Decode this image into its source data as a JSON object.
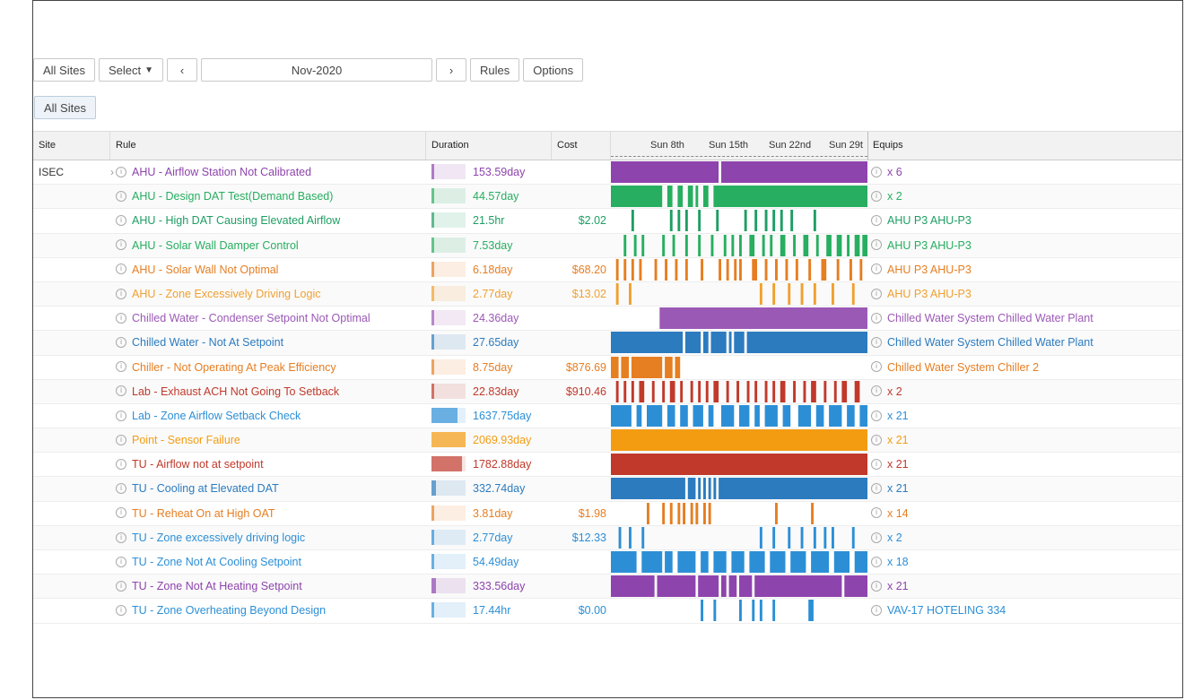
{
  "toolbar": {
    "all_sites": "All Sites",
    "select": "Select",
    "select_caret": "▼",
    "prev": "‹",
    "month": "Nov-2020",
    "next": "›",
    "rules": "Rules",
    "options": "Options"
  },
  "filter_tag": "All Sites",
  "columns": {
    "site": "Site",
    "rule": "Rule",
    "duration": "Duration",
    "cost": "Cost",
    "equips": "Equips"
  },
  "timeline_ticks": [
    "Sun 8th",
    "Sun 15th",
    "Sun 22nd",
    "Sun 29t"
  ],
  "rows": [
    {
      "site": "ISEC",
      "rule": "AHU - Airflow Station Not Calibrated",
      "color": "#8e44ad",
      "duration": "153.59day",
      "duration_fraction": 0.07,
      "cost": "",
      "equips": "x 6",
      "timeline": [
        [
          0,
          0.42
        ],
        [
          0.43,
          1
        ]
      ]
    },
    {
      "site": "",
      "rule": "AHU - Design DAT Test(Demand Based)",
      "color": "#27ae60",
      "duration": "44.57day",
      "duration_fraction": 0.02,
      "cost": "",
      "equips": "x 2",
      "timeline": [
        [
          0,
          0.2
        ],
        [
          0.22,
          0.24
        ],
        [
          0.26,
          0.28
        ],
        [
          0.3,
          0.32
        ],
        [
          0.33,
          0.34
        ],
        [
          0.36,
          0.38
        ],
        [
          0.4,
          1
        ]
      ]
    },
    {
      "site": "",
      "rule": "AHU - High DAT Causing Elevated Airflow",
      "color": "#1e9e64",
      "duration": "21.5hr",
      "duration_fraction": 0.01,
      "cost": "$2.02",
      "equips": "AHU P3 AHU-P3",
      "timeline": [
        [
          0.08,
          0.09
        ],
        [
          0.23,
          0.24
        ],
        [
          0.26,
          0.27
        ],
        [
          0.29,
          0.3
        ],
        [
          0.34,
          0.35
        ],
        [
          0.41,
          0.42
        ],
        [
          0.52,
          0.53
        ],
        [
          0.56,
          0.57
        ],
        [
          0.6,
          0.61
        ],
        [
          0.63,
          0.64
        ],
        [
          0.66,
          0.67
        ],
        [
          0.7,
          0.71
        ],
        [
          0.79,
          0.8
        ]
      ]
    },
    {
      "site": "",
      "rule": "AHU - Solar Wall Damper Control",
      "color": "#27ae60",
      "duration": "7.53day",
      "duration_fraction": 0.01,
      "cost": "",
      "equips": "AHU P3 AHU-P3",
      "timeline": [
        [
          0.05,
          0.06
        ],
        [
          0.09,
          0.1
        ],
        [
          0.12,
          0.13
        ],
        [
          0.2,
          0.21
        ],
        [
          0.24,
          0.25
        ],
        [
          0.29,
          0.3
        ],
        [
          0.34,
          0.35
        ],
        [
          0.39,
          0.4
        ],
        [
          0.44,
          0.45
        ],
        [
          0.47,
          0.48
        ],
        [
          0.5,
          0.51
        ],
        [
          0.54,
          0.56
        ],
        [
          0.59,
          0.6
        ],
        [
          0.62,
          0.63
        ],
        [
          0.66,
          0.68
        ],
        [
          0.71,
          0.72
        ],
        [
          0.75,
          0.77
        ],
        [
          0.8,
          0.81
        ],
        [
          0.84,
          0.86
        ],
        [
          0.88,
          0.9
        ],
        [
          0.92,
          0.93
        ],
        [
          0.95,
          0.97
        ],
        [
          0.98,
          1
        ]
      ]
    },
    {
      "site": "",
      "rule": "AHU - Solar Wall Not Optimal",
      "color": "#e67e22",
      "duration": "6.18day",
      "duration_fraction": 0.01,
      "cost": "$68.20",
      "equips": "AHU P3 AHU-P3",
      "timeline": [
        [
          0.02,
          0.03
        ],
        [
          0.05,
          0.06
        ],
        [
          0.08,
          0.09
        ],
        [
          0.11,
          0.12
        ],
        [
          0.17,
          0.18
        ],
        [
          0.21,
          0.22
        ],
        [
          0.25,
          0.26
        ],
        [
          0.29,
          0.3
        ],
        [
          0.35,
          0.36
        ],
        [
          0.42,
          0.43
        ],
        [
          0.45,
          0.46
        ],
        [
          0.48,
          0.49
        ],
        [
          0.5,
          0.51
        ],
        [
          0.55,
          0.57
        ],
        [
          0.6,
          0.61
        ],
        [
          0.64,
          0.65
        ],
        [
          0.68,
          0.69
        ],
        [
          0.72,
          0.73
        ],
        [
          0.77,
          0.78
        ],
        [
          0.82,
          0.84
        ],
        [
          0.88,
          0.89
        ],
        [
          0.93,
          0.94
        ],
        [
          0.97,
          0.98
        ]
      ]
    },
    {
      "site": "",
      "rule": "AHU - Zone Excessively Driving Logic",
      "color": "#f0a030",
      "duration": "2.77day",
      "duration_fraction": 0.01,
      "cost": "$13.02",
      "equips": "AHU P3 AHU-P3",
      "timeline": [
        [
          0.02,
          0.03
        ],
        [
          0.07,
          0.08
        ],
        [
          0.58,
          0.59
        ],
        [
          0.63,
          0.64
        ],
        [
          0.69,
          0.7
        ],
        [
          0.74,
          0.75
        ],
        [
          0.79,
          0.8
        ],
        [
          0.86,
          0.87
        ],
        [
          0.94,
          0.95
        ]
      ]
    },
    {
      "site": "",
      "rule": "Chilled Water - Condenser Setpoint Not Optimal",
      "color": "#9b59b6",
      "duration": "24.36day",
      "duration_fraction": 0.01,
      "cost": "",
      "equips": "Chilled Water System Chilled Water Plant",
      "timeline": [
        [
          0.19,
          1
        ]
      ]
    },
    {
      "site": "",
      "rule": "Chilled Water - Not At Setpoint",
      "color": "#2c7bbf",
      "duration": "27.65day",
      "duration_fraction": 0.01,
      "cost": "",
      "equips": "Chilled Water System Chilled Water Plant",
      "timeline": [
        [
          0,
          0.28
        ],
        [
          0.29,
          0.35
        ],
        [
          0.36,
          0.38
        ],
        [
          0.39,
          0.45
        ],
        [
          0.46,
          0.47
        ],
        [
          0.48,
          0.52
        ],
        [
          0.53,
          1
        ]
      ]
    },
    {
      "site": "",
      "rule": "Chiller - Not Operating At Peak Efficiency",
      "color": "#e67e22",
      "duration": "8.75day",
      "duration_fraction": 0.01,
      "cost": "$876.69",
      "equips": "Chilled Water System Chiller 2",
      "timeline": [
        [
          0,
          0.03
        ],
        [
          0.04,
          0.07
        ],
        [
          0.08,
          0.2
        ],
        [
          0.21,
          0.24
        ],
        [
          0.25,
          0.27
        ]
      ]
    },
    {
      "site": "",
      "rule": "Lab - Exhaust ACH Not Going To Setback",
      "color": "#c0392b",
      "duration": "22.83day",
      "duration_fraction": 0.01,
      "cost": "$910.46",
      "equips": "x 2",
      "timeline": [
        [
          0.02,
          0.03
        ],
        [
          0.05,
          0.06
        ],
        [
          0.08,
          0.09
        ],
        [
          0.11,
          0.13
        ],
        [
          0.16,
          0.17
        ],
        [
          0.2,
          0.21
        ],
        [
          0.23,
          0.25
        ],
        [
          0.27,
          0.28
        ],
        [
          0.31,
          0.32
        ],
        [
          0.34,
          0.35
        ],
        [
          0.37,
          0.38
        ],
        [
          0.4,
          0.42
        ],
        [
          0.45,
          0.46
        ],
        [
          0.49,
          0.5
        ],
        [
          0.53,
          0.54
        ],
        [
          0.56,
          0.57
        ],
        [
          0.6,
          0.61
        ],
        [
          0.63,
          0.64
        ],
        [
          0.66,
          0.68
        ],
        [
          0.71,
          0.72
        ],
        [
          0.75,
          0.76
        ],
        [
          0.78,
          0.8
        ],
        [
          0.83,
          0.84
        ],
        [
          0.87,
          0.88
        ],
        [
          0.9,
          0.92
        ],
        [
          0.95,
          0.97
        ]
      ]
    },
    {
      "site": "",
      "rule": "Lab - Zone Airflow Setback Check",
      "color": "#2c8fd6",
      "duration": "1637.75day",
      "duration_fraction": 0.75,
      "cost": "",
      "equips": "x 21",
      "timeline": [
        [
          0,
          0.08
        ],
        [
          0.1,
          0.12
        ],
        [
          0.14,
          0.2
        ],
        [
          0.22,
          0.25
        ],
        [
          0.27,
          0.3
        ],
        [
          0.32,
          0.36
        ],
        [
          0.38,
          0.4
        ],
        [
          0.43,
          0.48
        ],
        [
          0.5,
          0.54
        ],
        [
          0.56,
          0.58
        ],
        [
          0.6,
          0.65
        ],
        [
          0.67,
          0.7
        ],
        [
          0.73,
          0.78
        ],
        [
          0.8,
          0.83
        ],
        [
          0.85,
          0.9
        ],
        [
          0.92,
          0.95
        ],
        [
          0.97,
          1
        ]
      ]
    },
    {
      "site": "",
      "rule": "Point - Sensor Failure",
      "color": "#f39c12",
      "duration": "2069.93day",
      "duration_fraction": 1.0,
      "cost": "",
      "equips": "x 21",
      "timeline": [
        [
          0,
          1
        ]
      ]
    },
    {
      "site": "",
      "rule": "TU - Airflow not at setpoint",
      "color": "#c0392b",
      "duration": "1782.88day",
      "duration_fraction": 0.9,
      "cost": "",
      "equips": "x 21",
      "timeline": [
        [
          0,
          1
        ]
      ]
    },
    {
      "site": "",
      "rule": "TU - Cooling at Elevated DAT",
      "color": "#2c7bbf",
      "duration": "332.74day",
      "duration_fraction": 0.12,
      "cost": "",
      "equips": "x 21",
      "timeline": [
        [
          0,
          0.29
        ],
        [
          0.3,
          0.33
        ],
        [
          0.34,
          0.35
        ],
        [
          0.36,
          0.37
        ],
        [
          0.38,
          0.39
        ],
        [
          0.4,
          0.41
        ],
        [
          0.42,
          1
        ]
      ]
    },
    {
      "site": "",
      "rule": "TU - Reheat On at High OAT",
      "color": "#e67e22",
      "duration": "3.81day",
      "duration_fraction": 0.01,
      "cost": "$1.98",
      "equips": "x 14",
      "timeline": [
        [
          0.14,
          0.15
        ],
        [
          0.2,
          0.21
        ],
        [
          0.23,
          0.24
        ],
        [
          0.26,
          0.27
        ],
        [
          0.28,
          0.29
        ],
        [
          0.31,
          0.32
        ],
        [
          0.33,
          0.34
        ],
        [
          0.36,
          0.37
        ],
        [
          0.38,
          0.39
        ],
        [
          0.64,
          0.65
        ],
        [
          0.78,
          0.79
        ]
      ]
    },
    {
      "site": "",
      "rule": "TU - Zone excessively driving logic",
      "color": "#2c8fd6",
      "duration": "2.77day",
      "duration_fraction": 0.01,
      "cost": "$12.33",
      "equips": "x 2",
      "timeline": [
        [
          0.03,
          0.04
        ],
        [
          0.07,
          0.08
        ],
        [
          0.12,
          0.13
        ],
        [
          0.58,
          0.59
        ],
        [
          0.63,
          0.64
        ],
        [
          0.69,
          0.7
        ],
        [
          0.74,
          0.75
        ],
        [
          0.79,
          0.8
        ],
        [
          0.83,
          0.84
        ],
        [
          0.86,
          0.87
        ],
        [
          0.94,
          0.95
        ]
      ]
    },
    {
      "site": "",
      "rule": "TU - Zone Not At Cooling Setpoint",
      "color": "#2c8fd6",
      "duration": "54.49day",
      "duration_fraction": 0.03,
      "cost": "",
      "equips": "x 18",
      "timeline": [
        [
          0,
          0.1
        ],
        [
          0.12,
          0.2
        ],
        [
          0.21,
          0.24
        ],
        [
          0.26,
          0.33
        ],
        [
          0.35,
          0.38
        ],
        [
          0.4,
          0.45
        ],
        [
          0.47,
          0.52
        ],
        [
          0.54,
          0.6
        ],
        [
          0.62,
          0.68
        ],
        [
          0.7,
          0.76
        ],
        [
          0.78,
          0.85
        ],
        [
          0.87,
          0.93
        ],
        [
          0.95,
          1
        ]
      ]
    },
    {
      "site": "",
      "rule": "TU - Zone Not At Heating Setpoint",
      "color": "#8e44ad",
      "duration": "333.56day",
      "duration_fraction": 0.12,
      "cost": "",
      "equips": "x 21",
      "timeline": [
        [
          0,
          0.17
        ],
        [
          0.18,
          0.33
        ],
        [
          0.34,
          0.42
        ],
        [
          0.43,
          0.45
        ],
        [
          0.46,
          0.49
        ],
        [
          0.5,
          0.55
        ],
        [
          0.56,
          0.9
        ],
        [
          0.91,
          1
        ]
      ]
    },
    {
      "site": "",
      "rule": "TU - Zone Overheating Beyond Design",
      "color": "#2c8fd6",
      "duration": "17.44hr",
      "duration_fraction": 0.01,
      "cost": "$0.00",
      "equips": "VAV-17 HOTELING 334",
      "timeline": [
        [
          0.35,
          0.36
        ],
        [
          0.4,
          0.41
        ],
        [
          0.5,
          0.51
        ],
        [
          0.55,
          0.56
        ],
        [
          0.58,
          0.59
        ],
        [
          0.63,
          0.64
        ],
        [
          0.77,
          0.79
        ]
      ]
    }
  ]
}
